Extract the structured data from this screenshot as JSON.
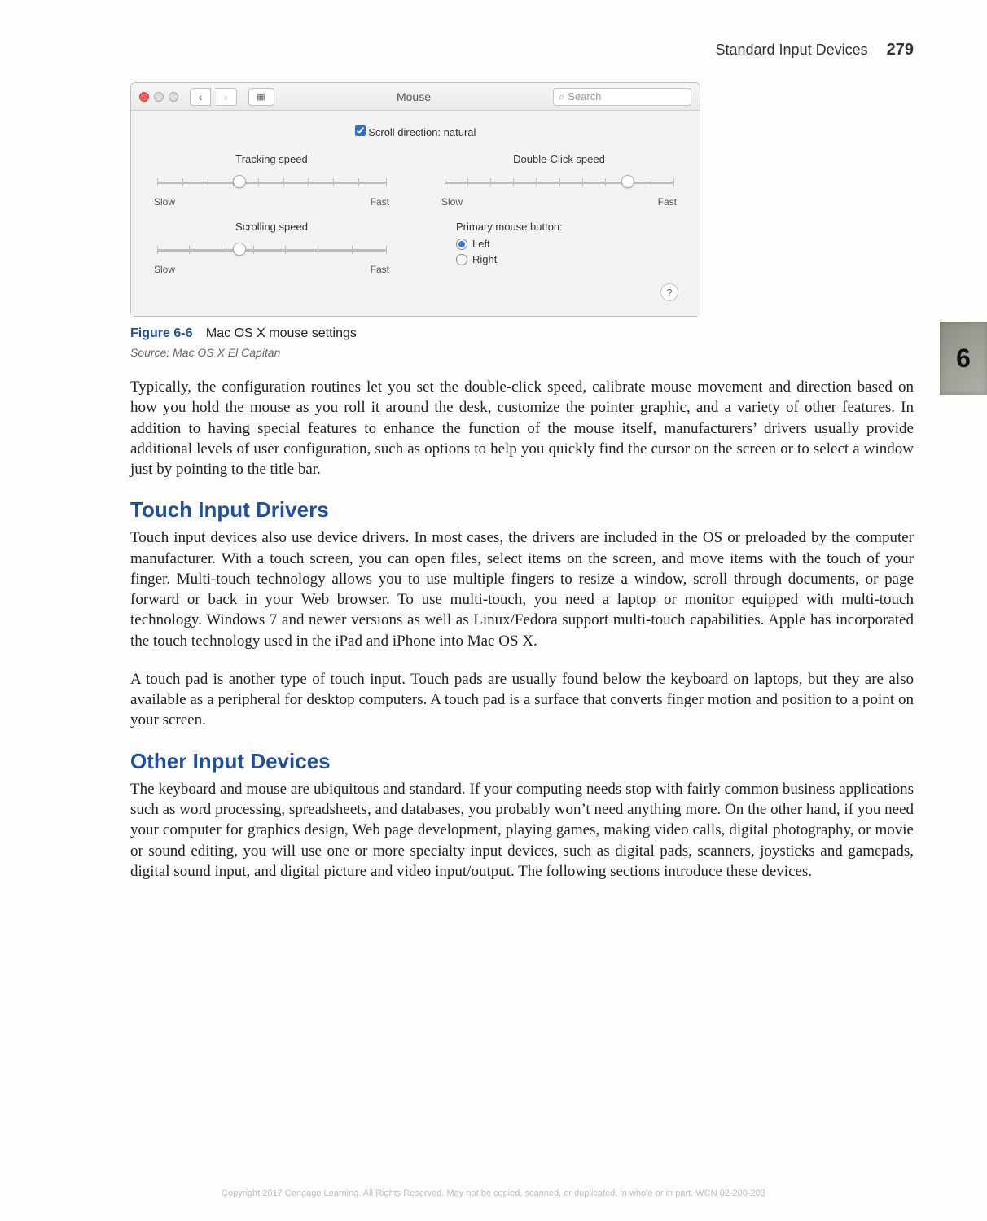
{
  "header": {
    "section": "Standard Input Devices",
    "page_number": "279"
  },
  "chapter_tab": "6",
  "mac_window": {
    "title": "Mouse",
    "search_placeholder": "Search",
    "scroll_checkbox_label": "Scroll direction: natural",
    "scroll_checked": true,
    "sliders": {
      "tracking": {
        "title": "Tracking speed",
        "min_label": "Slow",
        "max_label": "Fast",
        "value_pct": 36
      },
      "double_click": {
        "title": "Double-Click speed",
        "min_label": "Slow",
        "max_label": "Fast",
        "value_pct": 80
      },
      "scrolling": {
        "title": "Scrolling speed",
        "min_label": "Slow",
        "max_label": "Fast",
        "value_pct": 36
      }
    },
    "primary_button": {
      "title": "Primary mouse button:",
      "options": [
        "Left",
        "Right"
      ],
      "selected": "Left"
    },
    "help_label": "?"
  },
  "figure": {
    "label": "Figure 6-6",
    "caption": "Mac OS X mouse settings",
    "source": "Source: Mac OS X El Capitan"
  },
  "paragraphs": {
    "p1": "Typically, the configuration routines let you set the double-click speed, calibrate mouse movement and direction based on how you hold the mouse as you roll it around the desk, customize the pointer graphic, and a variety of other features. In addition to having special features to enhance the function of the mouse itself, manufacturers’ drivers usually provide additional levels of user configuration, such as options to help you quickly find the cursor on the screen or to select a window just by pointing to the title bar."
  },
  "sections": {
    "touch": {
      "heading": "Touch Input Drivers",
      "p1": "Touch input devices also use device drivers. In most cases, the drivers are included in the OS or preloaded by the computer manufacturer. With a touch screen, you can open files, select items on the screen, and move items with the touch of your finger. Multi-touch technology allows you to use multiple fingers to resize a window, scroll through documents, or page forward or back in your Web browser. To use multi-touch, you need a laptop or monitor equipped with multi-touch technology. Windows 7 and newer versions as well as Linux/Fedora support multi-touch capabilities. Apple has incorporated the touch technology used in the iPad and iPhone into Mac OS X.",
      "p2": "A touch pad is another type of touch input. Touch pads are usually found below the keyboard on laptops, but they are also available as a peripheral for desktop computers. A touch pad is a surface that converts finger motion and position to a point on your screen."
    },
    "other": {
      "heading": "Other Input Devices",
      "p1": "The keyboard and mouse are ubiquitous and standard. If your computing needs stop with fairly common business applications such as word processing, spreadsheets, and databases, you probably won’t need anything more. On the other hand, if you need your computer for graphics design, Web page development, playing games, making video calls, digital photography, or movie or sound editing, you will use one or more specialty input devices, such as digital pads, scanners, joysticks and gamepads, digital sound input, and digital picture and video input/output. The following sections introduce these devices."
    }
  },
  "copyright": "Copyright 2017 Cengage Learning. All Rights Reserved. May not be copied, scanned, or duplicated, in whole or in part.  WCN 02-200-203"
}
